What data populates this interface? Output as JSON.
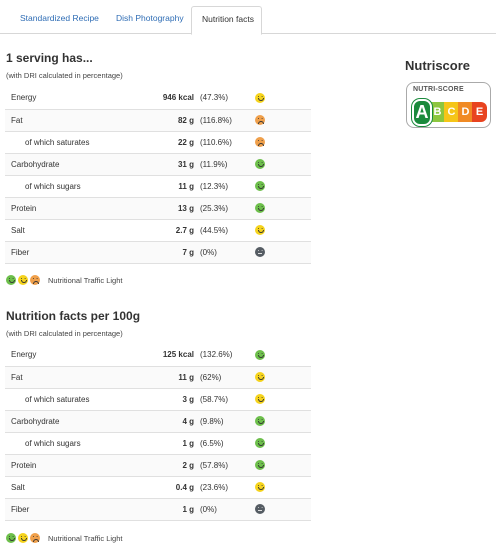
{
  "tabs": [
    {
      "label": "Standardized Recipe"
    },
    {
      "label": "Dish Photography"
    },
    {
      "label": "Nutrition facts"
    }
  ],
  "serving": {
    "title": "1 serving has...",
    "note": "(with DRI calculated in percentage)",
    "rows": [
      {
        "label": "Energy",
        "value": "946 kcal",
        "pct": "(47.3%)",
        "light": "yellow"
      },
      {
        "label": "Fat",
        "value": "82 g",
        "pct": "(116.8%)",
        "light": "orange"
      },
      {
        "label": "of which saturates",
        "value": "22 g",
        "pct": "(110.6%)",
        "light": "orange"
      },
      {
        "label": "Carbohydrate",
        "value": "31 g",
        "pct": "(11.9%)",
        "light": "green"
      },
      {
        "label": "of which sugars",
        "value": "11 g",
        "pct": "(12.3%)",
        "light": "green"
      },
      {
        "label": "Protein",
        "value": "13 g",
        "pct": "(25.3%)",
        "light": "green"
      },
      {
        "label": "Salt",
        "value": "2.7 g",
        "pct": "(44.5%)",
        "light": "yellow"
      },
      {
        "label": "Fiber",
        "value": "7 g",
        "pct": "(0%)",
        "light": "dark"
      }
    ],
    "legend": "Nutritional Traffic Light"
  },
  "per100": {
    "title": "Nutrition facts per 100g",
    "note": "(with DRI calculated in percentage)",
    "rows": [
      {
        "label": "Energy",
        "value": "125 kcal",
        "pct": "(132.6%)",
        "light": "green"
      },
      {
        "label": "Fat",
        "value": "11 g",
        "pct": "(62%)",
        "light": "yellow"
      },
      {
        "label": "of which saturates",
        "value": "3 g",
        "pct": "(58.7%)",
        "light": "yellow"
      },
      {
        "label": "Carbohydrate",
        "value": "4 g",
        "pct": "(9.8%)",
        "light": "green"
      },
      {
        "label": "of which sugars",
        "value": "1 g",
        "pct": "(6.5%)",
        "light": "green"
      },
      {
        "label": "Protein",
        "value": "2 g",
        "pct": "(57.8%)",
        "light": "green"
      },
      {
        "label": "Salt",
        "value": "0.4 g",
        "pct": "(23.6%)",
        "light": "yellow"
      },
      {
        "label": "Fiber",
        "value": "1 g",
        "pct": "(0%)",
        "light": "dark"
      }
    ],
    "legend": "Nutritional Traffic Light"
  },
  "nutriscore": {
    "title": "Nutriscore",
    "badge_heading": "NUTRI-SCORE",
    "grade": "A",
    "letters": [
      "B",
      "C",
      "D",
      "E"
    ],
    "colors": {
      "A": "#1a8a3c",
      "B": "#8cc63f",
      "C": "#f5c518",
      "D": "#f08a24",
      "E": "#e8431f"
    }
  },
  "colors": {
    "green": "#6dbf4b",
    "yellow": "#f5d31d",
    "orange": "#f0a04b",
    "dark": "#555c63",
    "link": "#2f6db5"
  }
}
